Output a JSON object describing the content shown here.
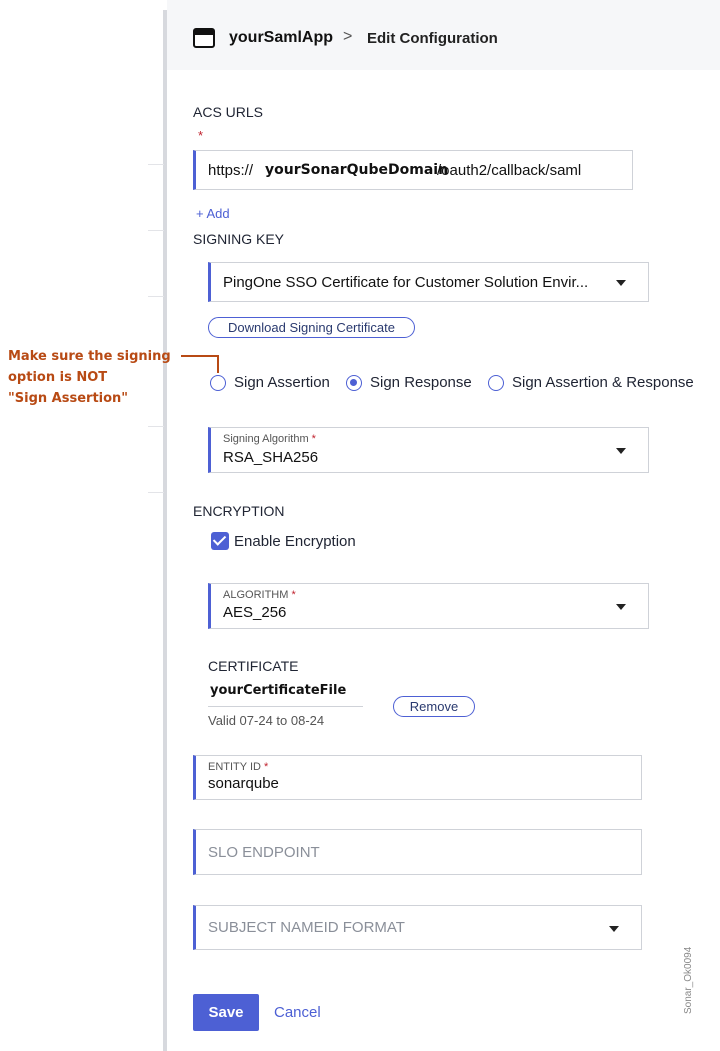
{
  "header": {
    "app_name": "yourSamlApp",
    "breadcrumb_separator": ">",
    "page_title": "Edit Configuration"
  },
  "acs": {
    "label": "ACS URLS",
    "required_mark": "*",
    "url_prefix": "https://",
    "url_domain": "yourSonarQubeDomain",
    "url_suffix": "/oauth2/callback/saml",
    "add_link": "+ Add"
  },
  "signing": {
    "label": "SIGNING KEY",
    "key_value": "PingOne SSO Certificate for Customer Solution Envir...",
    "download_button": "Download Signing Certificate",
    "radio_options": [
      {
        "label": "Sign Assertion",
        "selected": false
      },
      {
        "label": "Sign Response",
        "selected": true
      },
      {
        "label": "Sign Assertion & Response",
        "selected": false
      }
    ],
    "algorithm_label": "Signing Algorithm",
    "algorithm_value": "RSA_SHA256"
  },
  "annotation": {
    "line1": "Make sure the signing",
    "line2": "option is NOT",
    "line3": "\"Sign Assertion\"",
    "color": "#b84a14"
  },
  "encryption": {
    "label": "ENCRYPTION",
    "enable_label": "Enable Encryption",
    "enabled": true,
    "algorithm_label": "ALGORITHM",
    "algorithm_value": "AES_256",
    "certificate_label": "CERTIFICATE",
    "certificate_file": "yourCertificateFile",
    "validity": "Valid 07-24 to 08-24",
    "remove_button": "Remove"
  },
  "entity": {
    "label": "ENTITY ID",
    "value": "sonarqube"
  },
  "slo": {
    "placeholder": "SLO ENDPOINT"
  },
  "nameid": {
    "placeholder": "SUBJECT NAMEID FORMAT"
  },
  "actions": {
    "save": "Save",
    "cancel": "Cancel"
  },
  "watermark": "Sonar_Ok0094",
  "colors": {
    "accent": "#4d60d4",
    "required": "#c0222e"
  }
}
